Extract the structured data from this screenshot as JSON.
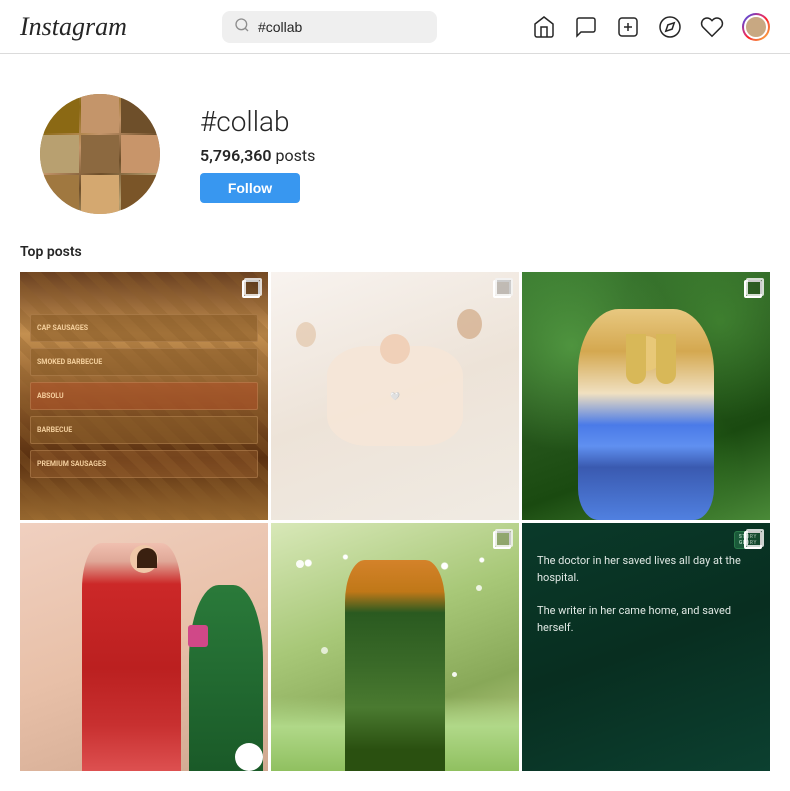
{
  "navbar": {
    "logo": "Instagram",
    "search_placeholder": "#collab",
    "search_value": "#collab"
  },
  "profile": {
    "hashtag": "#collab",
    "post_count": "5,796,360",
    "post_label": "posts",
    "follow_button": "Follow"
  },
  "sections": {
    "top_posts_label": "Top posts"
  },
  "posts": [
    {
      "id": 1,
      "type": "food",
      "has_multiple": true
    },
    {
      "id": 2,
      "type": "baby",
      "has_multiple": true
    },
    {
      "id": 3,
      "type": "fashion",
      "has_multiple": true
    },
    {
      "id": 4,
      "type": "fashion2",
      "has_multiple": false
    },
    {
      "id": 5,
      "type": "outdoor",
      "has_multiple": true
    },
    {
      "id": 6,
      "type": "quote",
      "has_multiple": true,
      "quote_line1": "The doctor in her saved lives all day at the hospital.",
      "quote_line2": "The writer in her came home, and saved herself."
    }
  ],
  "icons": {
    "home": "home",
    "messenger": "chat",
    "add": "plus",
    "explore": "compass",
    "heart": "heart",
    "profile": "avatar"
  }
}
